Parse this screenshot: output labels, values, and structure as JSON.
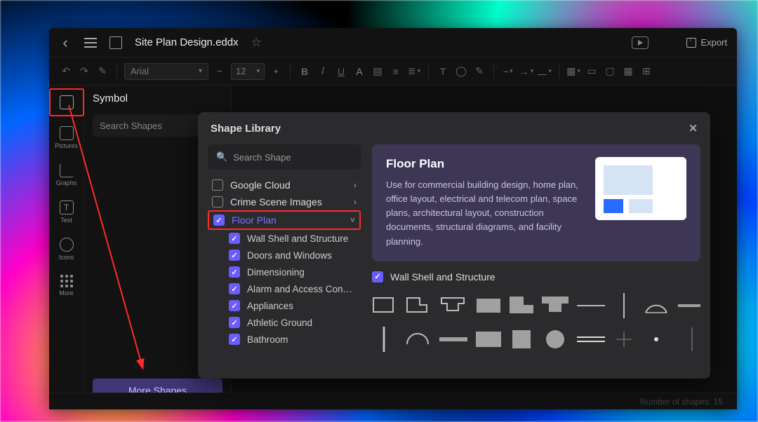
{
  "header": {
    "filename": "Site Plan Design.eddx",
    "export_label": "Export"
  },
  "toolbar": {
    "font": "Arial",
    "size": "12"
  },
  "rail": [
    {
      "label": "",
      "active": true
    },
    {
      "label": "Pictures"
    },
    {
      "label": "Graphs"
    },
    {
      "label": "Text"
    },
    {
      "label": "Icons"
    },
    {
      "label": "More"
    }
  ],
  "symbol_panel": {
    "title": "Symbol",
    "search_placeholder": "Search Shapes",
    "more_shapes": "More Shapes"
  },
  "modal": {
    "title": "Shape Library",
    "search_placeholder": "Search Shape",
    "tree": [
      {
        "label": "Google Cloud",
        "checked": false,
        "type": "parent",
        "expand": "›"
      },
      {
        "label": "Crime Scene Images",
        "checked": false,
        "type": "parent",
        "expand": "›"
      },
      {
        "label": "Floor Plan",
        "checked": true,
        "type": "parent",
        "expand": "˅",
        "selected": true
      },
      {
        "label": "Wall Shell and Structure",
        "checked": true,
        "type": "child"
      },
      {
        "label": "Doors and Windows",
        "checked": true,
        "type": "child"
      },
      {
        "label": "Dimensioning",
        "checked": true,
        "type": "child"
      },
      {
        "label": "Alarm and Access Con…",
        "checked": true,
        "type": "child"
      },
      {
        "label": "Appliances",
        "checked": true,
        "type": "child"
      },
      {
        "label": "Athletic Ground",
        "checked": true,
        "type": "child"
      },
      {
        "label": "Bathroom",
        "checked": true,
        "type": "child"
      }
    ],
    "desc": {
      "title": "Floor Plan",
      "text": "Use for commercial building design, home plan, office layout, electrical and telecom plan, space plans, architectural layout, construction documents, structural diagrams, and facility planning."
    },
    "section_title": "Wall Shell and Structure"
  },
  "status": {
    "shapes": "Number of shapes: 15"
  }
}
